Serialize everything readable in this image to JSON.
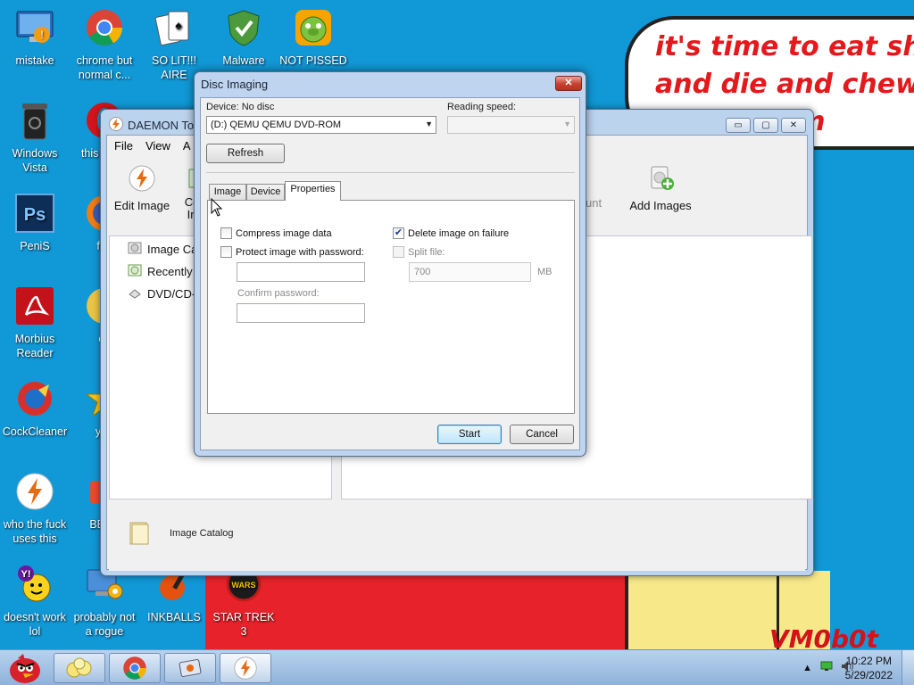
{
  "desktop": {
    "speech_bubble_text": "it's time to eat shit\nand die and chew\nbubblegum",
    "signature": "VM0b0t",
    "icons": [
      {
        "label": "mistake"
      },
      {
        "label": "chrome but normal c..."
      },
      {
        "label": "SO LIT!!! AIRE"
      },
      {
        "label": "Malware"
      },
      {
        "label": "NOT PISSED"
      },
      {
        "label": "Windows Vista"
      },
      {
        "label": "this like a"
      },
      {
        "label": "PeniS"
      },
      {
        "label": "furi"
      },
      {
        "label": "Morbius Reader"
      },
      {
        "label": "cd"
      },
      {
        "label": "CockCleaner"
      },
      {
        "label": "you"
      },
      {
        "label": "who the fuck uses this"
      },
      {
        "label": "BEEP"
      },
      {
        "label": "doesn't work lol"
      },
      {
        "label": "probably not a rogue"
      },
      {
        "label": "INKBALLS"
      },
      {
        "label": "STAR TREK 3"
      }
    ]
  },
  "daemon_window": {
    "title": "DAEMON To",
    "menu": [
      "File",
      "View",
      "A"
    ],
    "toolbar": {
      "edit_image": "Edit Image",
      "convert_line1": "Co",
      "convert_line2": "In",
      "unmount": "unt",
      "add_images": "Add Images"
    },
    "tree": [
      "Image Ca",
      "Recently",
      "DVD/CD-"
    ],
    "bottom_label": "Image Catalog",
    "window_buttons": {
      "minimize": "▭",
      "maximize": "▢",
      "close": "✕"
    }
  },
  "dialog": {
    "title": "Disc Imaging",
    "close_label": "✕",
    "device_label": "Device: No disc",
    "device_value": "(D:) QEMU QEMU DVD-ROM",
    "reading_speed_label": "Reading speed:",
    "reading_speed_value": "",
    "refresh_label": "Refresh",
    "tabs": [
      "Image",
      "Device",
      "Properties"
    ],
    "active_tab": "Properties",
    "properties": {
      "compress_label": "Compress image data",
      "compress_checked": false,
      "protect_label": "Protect image with password:",
      "protect_checked": false,
      "password_value": "",
      "confirm_label": "Confirm password:",
      "confirm_value": "",
      "delete_label": "Delete image on failure",
      "delete_checked": true,
      "split_label": "Split file:",
      "split_checked": false,
      "split_value": "700",
      "split_unit": "MB"
    },
    "start_label": "Start",
    "cancel_label": "Cancel"
  },
  "taskbar": {
    "time": "10:22 PM",
    "date": "5/29/2022"
  }
}
